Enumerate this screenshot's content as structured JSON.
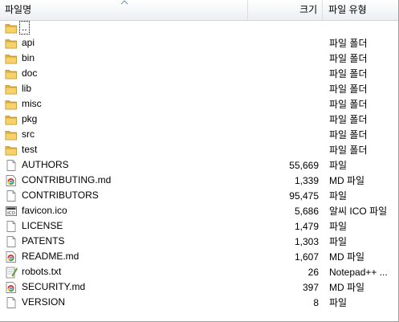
{
  "columns": {
    "name": "파일명",
    "size": "크기",
    "type": "파일 유형"
  },
  "rows": [
    {
      "name": "..",
      "size": "",
      "type": "",
      "icon": "folder-icon"
    },
    {
      "name": "api",
      "size": "",
      "type": "파일 폴더",
      "icon": "folder-icon"
    },
    {
      "name": "bin",
      "size": "",
      "type": "파일 폴더",
      "icon": "folder-icon"
    },
    {
      "name": "doc",
      "size": "",
      "type": "파일 폴더",
      "icon": "folder-icon"
    },
    {
      "name": "lib",
      "size": "",
      "type": "파일 폴더",
      "icon": "folder-icon"
    },
    {
      "name": "misc",
      "size": "",
      "type": "파일 폴더",
      "icon": "folder-icon"
    },
    {
      "name": "pkg",
      "size": "",
      "type": "파일 폴더",
      "icon": "folder-icon"
    },
    {
      "name": "src",
      "size": "",
      "type": "파일 폴더",
      "icon": "folder-icon"
    },
    {
      "name": "test",
      "size": "",
      "type": "파일 폴더",
      "icon": "folder-icon"
    },
    {
      "name": "AUTHORS",
      "size": "55,669",
      "type": "파일",
      "icon": "file-icon"
    },
    {
      "name": "CONTRIBUTING.md",
      "size": "1,339",
      "type": "MD 파일",
      "icon": "chrome-file-icon"
    },
    {
      "name": "CONTRIBUTORS",
      "size": "95,475",
      "type": "파일",
      "icon": "file-icon"
    },
    {
      "name": "favicon.ico",
      "size": "5,686",
      "type": "알씨 ICO 파일",
      "icon": "ico-file-icon"
    },
    {
      "name": "LICENSE",
      "size": "1,479",
      "type": "파일",
      "icon": "file-icon"
    },
    {
      "name": "PATENTS",
      "size": "1,303",
      "type": "파일",
      "icon": "file-icon"
    },
    {
      "name": "README.md",
      "size": "1,607",
      "type": "MD 파일",
      "icon": "chrome-file-icon"
    },
    {
      "name": "robots.txt",
      "size": "26",
      "type": "Notepad++ ...",
      "icon": "notepad-file-icon"
    },
    {
      "name": "SECURITY.md",
      "size": "397",
      "type": "MD 파일",
      "icon": "chrome-file-icon"
    },
    {
      "name": "VERSION",
      "size": "8",
      "type": "파일",
      "icon": "file-icon"
    }
  ]
}
